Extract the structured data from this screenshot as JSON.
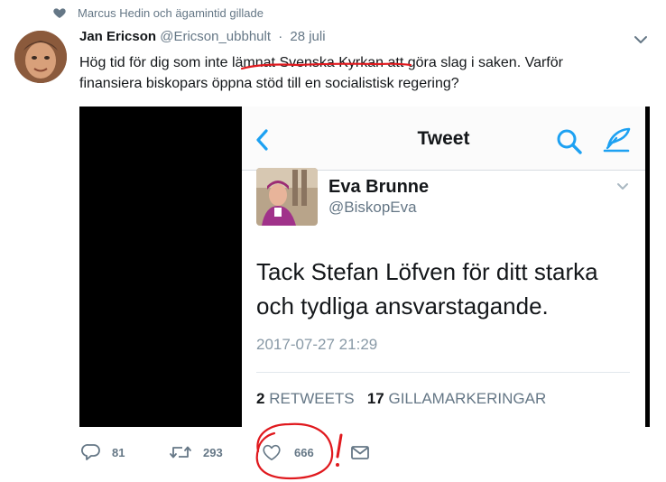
{
  "context": {
    "text": "Marcus Hedin och ägamintid gillade"
  },
  "tweet": {
    "name": "Jan Ericson",
    "handle": "@Ericson_ubbhult",
    "separator": "·",
    "date": "28 juli",
    "text_line1": "Hög tid för dig som inte lämnat Svenska Kyrkan att göra slag i saken. Varför",
    "text_line2": "finansiera biskopars öppna stöd till en socialistisk regering?"
  },
  "embedded": {
    "nav_title": "Tweet",
    "name": "Eva Brunne",
    "handle": "@BiskopEva",
    "text_line1": "Tack Stefan Löfven för ditt starka",
    "text_line2": "och tydliga ansvarstagande.",
    "timestamp": "2017-07-27 21:29",
    "retweet_count": "2",
    "retweet_label": "RETWEETS",
    "like_count": "17",
    "like_label": "GILLAMARKERINGAR"
  },
  "actions": {
    "reply_count": "81",
    "retweet_count": "293",
    "like_count": "666"
  },
  "annotation": {
    "exclamation": "!"
  },
  "colors": {
    "accent": "#1da1f2",
    "muted": "#657786",
    "annotation_red": "#e0191e"
  },
  "icons": [
    "heart-icon",
    "chevron-down-icon",
    "back-chevron-icon",
    "search-icon",
    "compose-icon",
    "reply-icon",
    "retweet-icon",
    "like-icon",
    "direct-message-icon"
  ]
}
